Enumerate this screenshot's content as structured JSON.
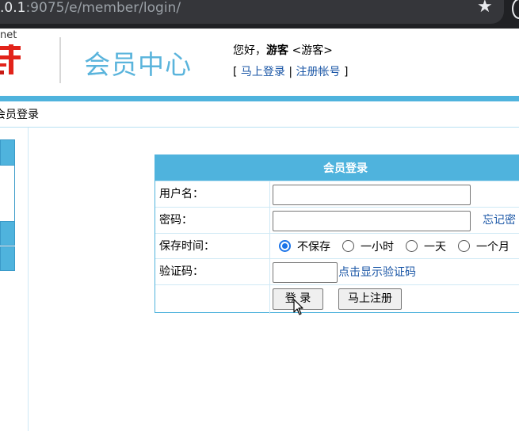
{
  "browser": {
    "url_host": ".0.1",
    "url_rest": ":9075/e/member/login/",
    "star_icon": "★",
    "star_icon_name": "bookmark-star-icon"
  },
  "header": {
    "logo_net": "net",
    "site_title": "会员中心",
    "greeting_prefix": "您好，",
    "username": "游客",
    "user_group": "<游客>",
    "link_bracket_open": "[",
    "link_login": "马上登录",
    "link_sep": "|",
    "link_register": "注册帐号",
    "link_bracket_close": "]"
  },
  "breadcrumb": "会员登录",
  "login_form": {
    "title": "会员登录",
    "username_label": "用户名：",
    "password_label": "密码：",
    "forgot_link": "忘记密",
    "save_time_label": "保存时间：",
    "save_options": [
      "不保存",
      "一小时",
      "一天",
      "一个月"
    ],
    "save_selected": "不保存",
    "captcha_label": "验证码：",
    "captcha_link": "点击显示验证码",
    "login_button": "登 录",
    "register_button": "马上注册"
  },
  "colors": {
    "accent": "#4fb3dd",
    "title": "#5ab4dc",
    "link": "#1a56a6",
    "radio": "#1a73e8"
  }
}
